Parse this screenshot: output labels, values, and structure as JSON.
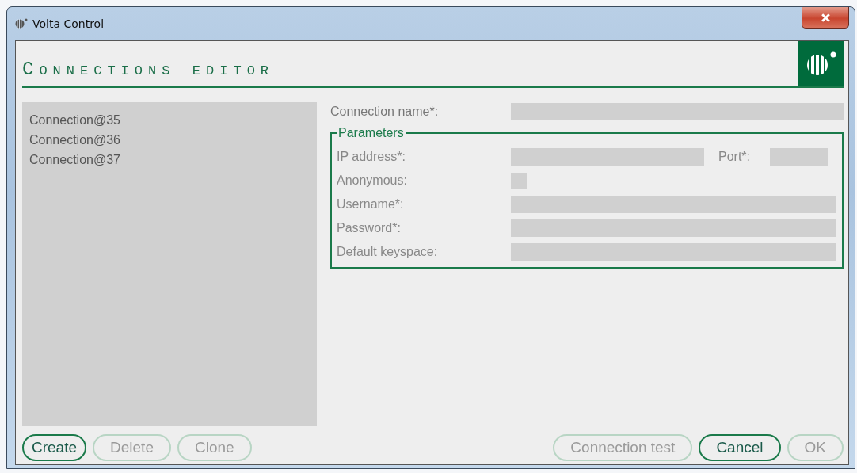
{
  "window": {
    "title": "Volta Control"
  },
  "header": {
    "title": "Connections editor"
  },
  "connections": [
    {
      "label": "Connection@35",
      "selected": false
    },
    {
      "label": "Connection@36",
      "selected": false
    },
    {
      "label": "Connection@37",
      "selected": false
    }
  ],
  "form": {
    "connection_name": {
      "label": "Connection name*:"
    },
    "parameters": {
      "title": "Parameters",
      "ip_address": {
        "label": "IP address*:"
      },
      "port": {
        "label": "Port*:"
      },
      "anonymous": {
        "label": "Anonymous:",
        "checked": false
      },
      "username": {
        "label": "Username*:"
      },
      "password": {
        "label": "Password*:"
      },
      "default_keyspace": {
        "label": "Default keyspace:"
      }
    }
  },
  "left_buttons": [
    {
      "label": "Create",
      "disabled": false
    },
    {
      "label": "Delete",
      "disabled": true
    },
    {
      "label": "Clone",
      "disabled": true
    }
  ],
  "right_buttons": [
    {
      "label": "Connection test",
      "disabled": true
    },
    {
      "label": "Cancel",
      "disabled": false
    },
    {
      "label": "OK",
      "disabled": true
    }
  ]
}
